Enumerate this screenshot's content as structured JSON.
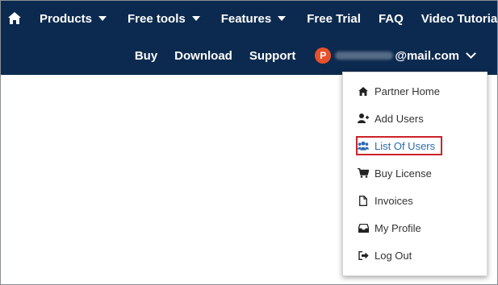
{
  "nav": {
    "top": [
      {
        "label": "Products",
        "caret": true
      },
      {
        "label": "Free tools",
        "caret": true
      },
      {
        "label": "Features",
        "caret": true
      },
      {
        "label": "Free Trial",
        "caret": false
      },
      {
        "label": "FAQ",
        "caret": false
      },
      {
        "label": "Video Tutorials",
        "caret": false
      }
    ],
    "secondary": {
      "buy": "Buy",
      "download": "Download",
      "support": "Support"
    },
    "account": {
      "avatar_letter": "P",
      "email_suffix": "@mail.com",
      "avatar_color": "#e8512b"
    },
    "background": "#0c2a4f"
  },
  "dropdown": {
    "items": [
      {
        "label": "Partner Home",
        "icon": "home-icon"
      },
      {
        "label": "Add Users",
        "icon": "add-user-icon"
      },
      {
        "label": "List Of Users",
        "icon": "users-icon",
        "active": true
      },
      {
        "label": "Buy License",
        "icon": "cart-icon"
      },
      {
        "label": "Invoices",
        "icon": "file-icon"
      },
      {
        "label": "My Profile",
        "icon": "inbox-icon"
      },
      {
        "label": "Log Out",
        "icon": "logout-icon"
      }
    ],
    "highlight_color": "#cc2229",
    "active_color": "#2b6cb0"
  }
}
